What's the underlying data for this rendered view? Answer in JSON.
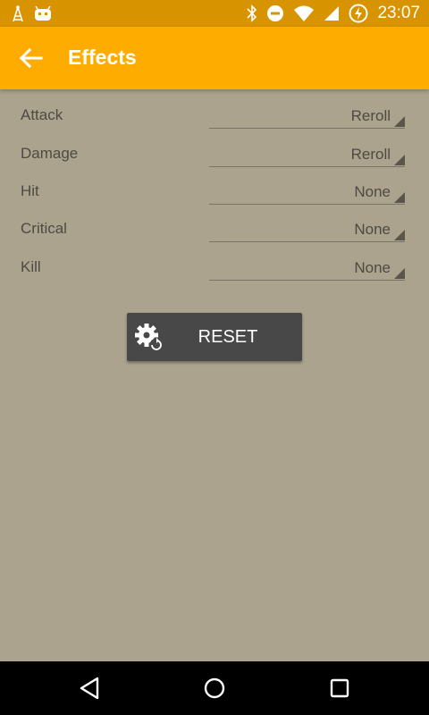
{
  "status_bar": {
    "time": "23:07",
    "left_icons": [
      "signal-tower-icon",
      "android-debug-icon"
    ],
    "right_icons": [
      "bluetooth-icon",
      "do-not-disturb-icon",
      "wifi-icon",
      "cell-signal-icon",
      "battery-charging-icon"
    ],
    "background": "#D79300"
  },
  "app_bar": {
    "title": "Effects",
    "back_icon": "arrow-back-icon",
    "background": "#FFAC00"
  },
  "settings": [
    {
      "label": "Attack",
      "value": "Reroll"
    },
    {
      "label": "Damage",
      "value": "Reroll"
    },
    {
      "label": "Hit",
      "value": "None"
    },
    {
      "label": "Critical",
      "value": "None"
    },
    {
      "label": "Kill",
      "value": "None"
    }
  ],
  "reset_button": {
    "label": "RESET",
    "icon": "settings-reset-icon",
    "background": "#484848"
  },
  "nav_bar": {
    "buttons": [
      "back-triangle-icon",
      "home-circle-icon",
      "recents-square-icon"
    ]
  },
  "colors": {
    "page_background": "#ABA38D",
    "text": "#4E4A42"
  }
}
